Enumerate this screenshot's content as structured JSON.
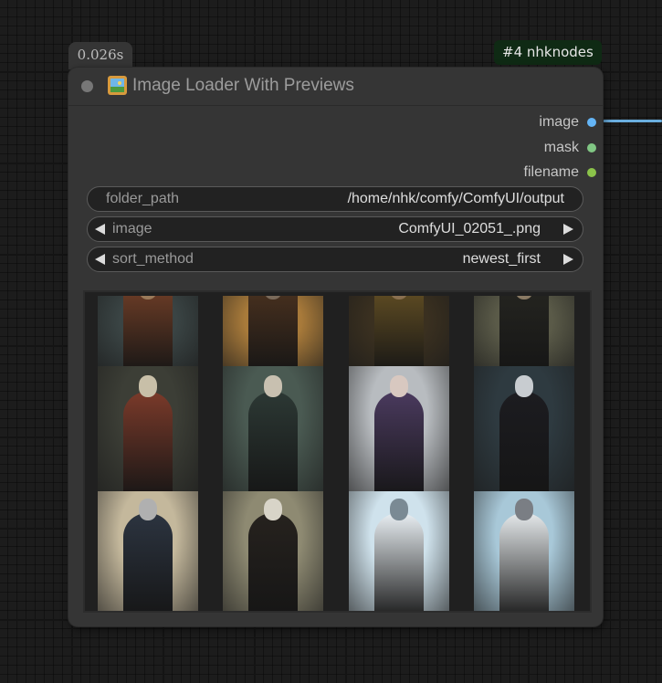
{
  "exec_time": "0.026s",
  "node_id_badge": "#4 nhknodes",
  "node": {
    "title": "Image Loader With Previews",
    "outputs": [
      {
        "label": "image",
        "color": "#64b5f6"
      },
      {
        "label": "mask",
        "color": "#81c784"
      },
      {
        "label": "filename",
        "color": "#8bc34a"
      }
    ],
    "widgets": {
      "folder_path": {
        "name": "folder_path",
        "value": "/home/nhk/comfy/ComfyUI/output"
      },
      "image": {
        "name": "image",
        "value": "ComfyUI_02051_.png"
      },
      "sort_method": {
        "name": "sort_method",
        "value": "newest_first"
      }
    }
  },
  "gallery": {
    "thumbnails": [
      {
        "subject": "robed-figure-crossed-arms",
        "bg": "#3a4444",
        "robe": "#8a4a2c",
        "face": "#9a7a5a"
      },
      {
        "subject": "robed-figure-seated",
        "bg": "#a87a3a",
        "robe": "#5a3a22",
        "face": "#7a6a5a"
      },
      {
        "subject": "robed-figure-clasped-hands",
        "bg": "#3a3020",
        "robe": "#7a6028",
        "face": "#8a7050"
      },
      {
        "subject": "hooded-figure-clasped-hands",
        "bg": "#5a5a48",
        "robe": "#2a2a24",
        "face": "#8a7a64"
      },
      {
        "subject": "skeleton-robed",
        "bg": "#3c3e36",
        "robe": "#7a3a2a",
        "face": "#c8bfa8"
      },
      {
        "subject": "elf-with-staff",
        "bg": "#4a5a52",
        "robe": "#2c3834",
        "face": "#c8c0b0"
      },
      {
        "subject": "white-haired-woman",
        "bg": "#b8bcc0",
        "robe": "#4a3a5e",
        "face": "#d8c8c0"
      },
      {
        "subject": "dark-witch",
        "bg": "#2e3a40",
        "robe": "#1c1c20",
        "face": "#c8ccd0"
      },
      {
        "subject": "antlered-robed-figure",
        "bg": "#c4b89c",
        "robe": "#2c3440",
        "face": "#b0b0b0"
      },
      {
        "subject": "masked-hooded-figure",
        "bg": "#8e8a72",
        "robe": "#26221e",
        "face": "#d8d4c8"
      },
      {
        "subject": "yeti",
        "bg": "#cfe2ec",
        "robe": "#e8eef2",
        "face": "#7a8a94"
      },
      {
        "subject": "yeti-with-staff",
        "bg": "#a8c8d8",
        "robe": "#e4e8ea",
        "face": "#7a7e84"
      }
    ]
  }
}
